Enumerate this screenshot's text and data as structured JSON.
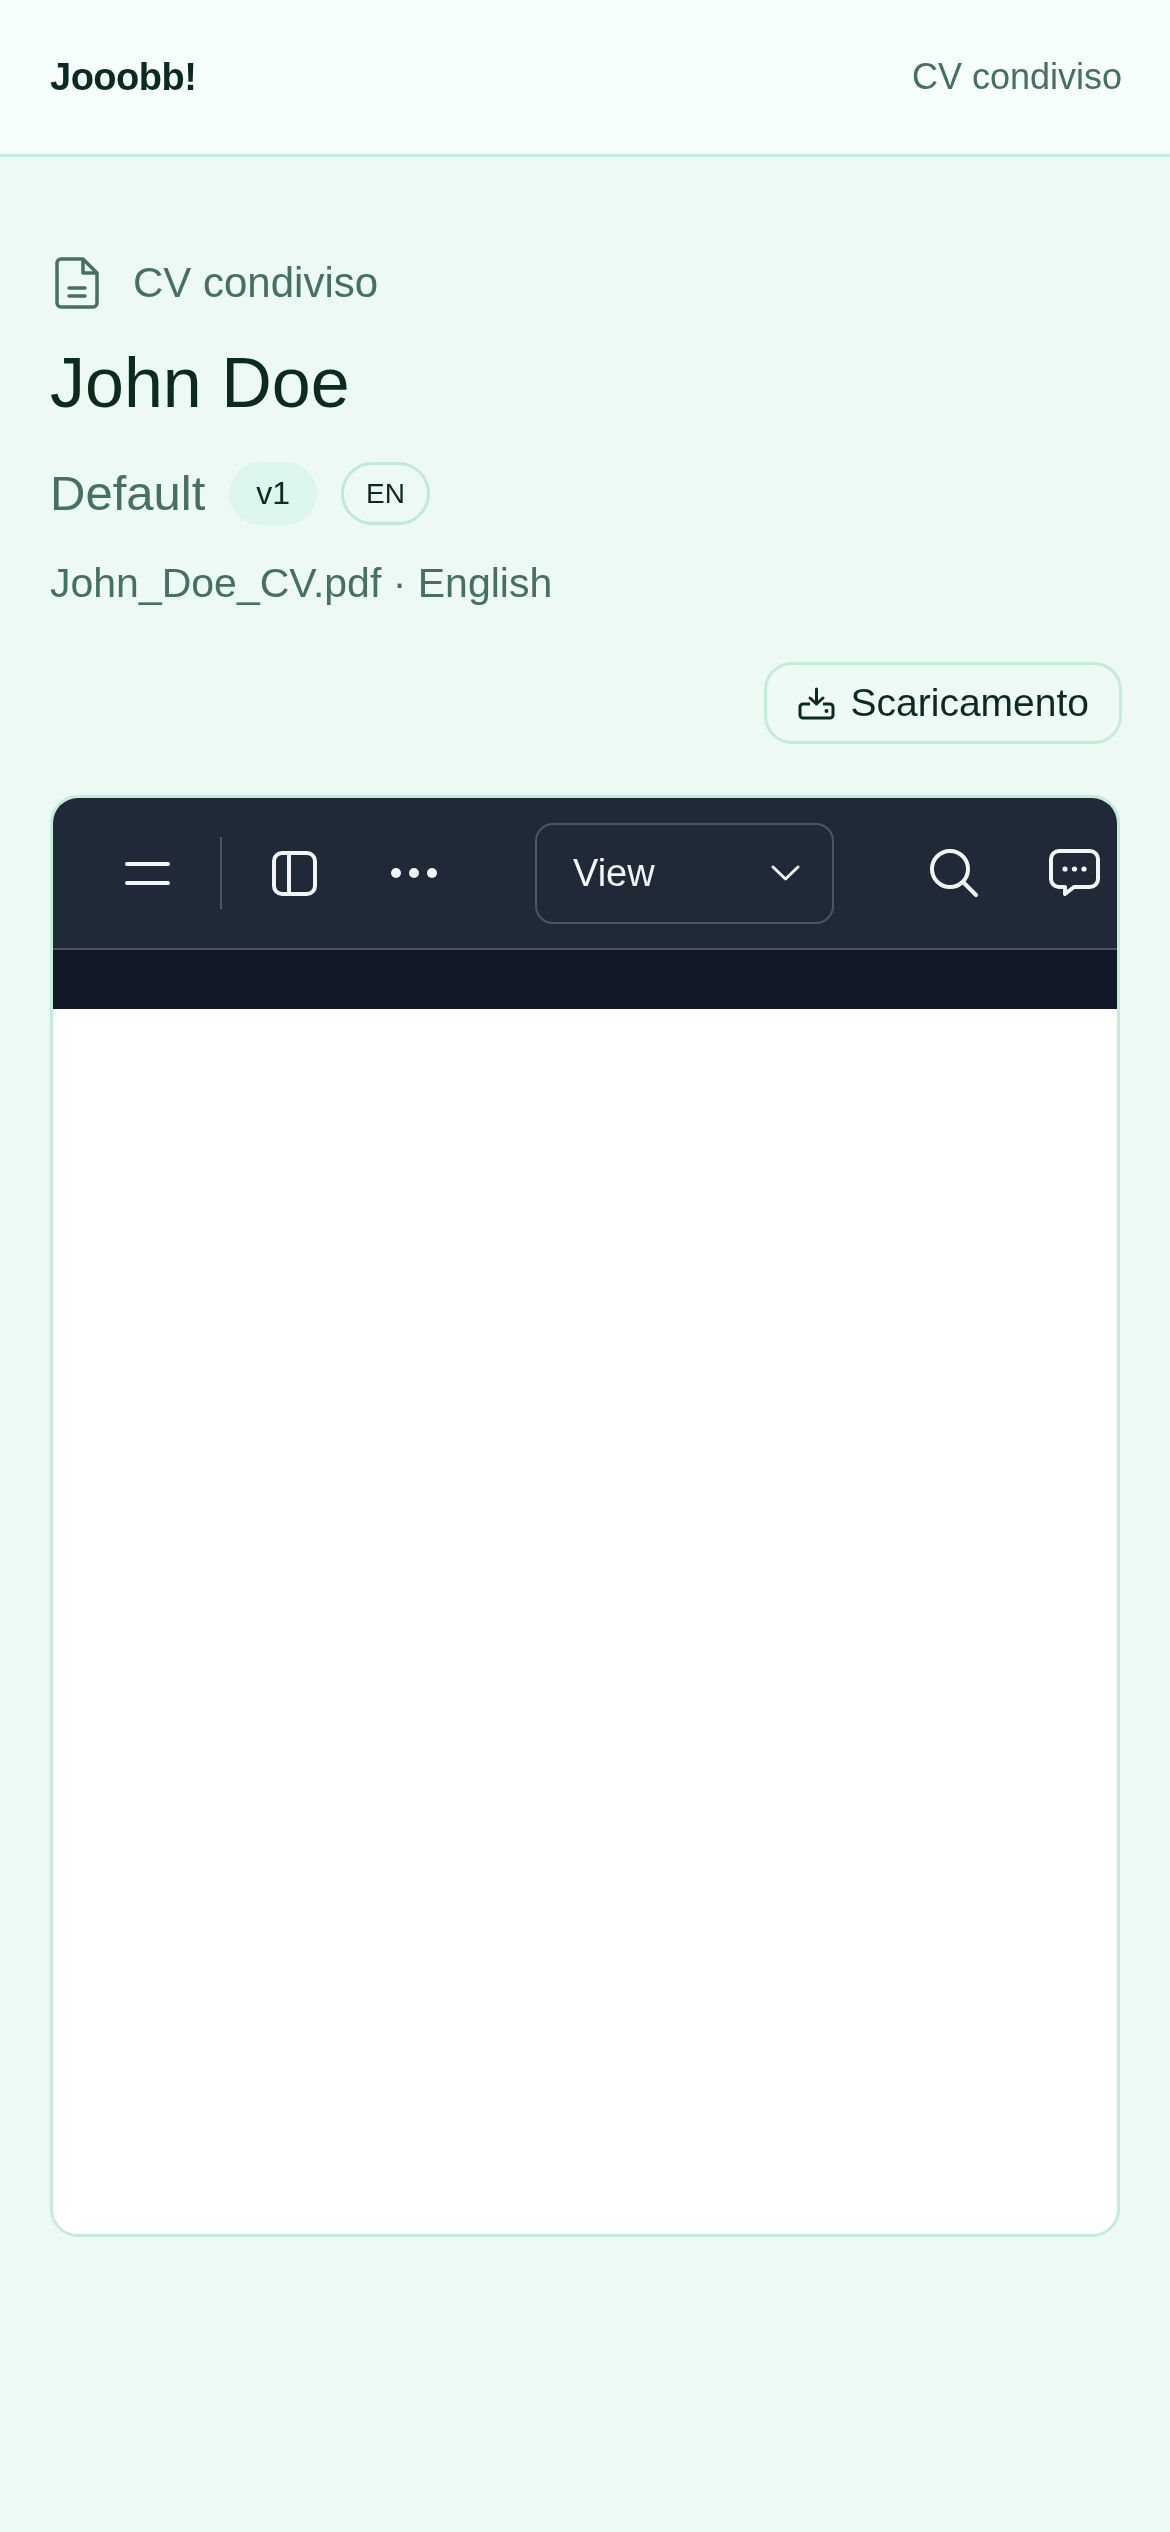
{
  "header": {
    "logo": "Jooobb!",
    "page_title": "CV condiviso"
  },
  "document": {
    "section_label": "CV condiviso",
    "name": "John Doe",
    "version_name": "Default",
    "badges": [
      {
        "kind": "filled",
        "label": "v1"
      },
      {
        "kind": "outline",
        "label": "EN"
      }
    ],
    "file_info": "John_Doe_CV.pdf · English",
    "download_button": "Scaricamento"
  },
  "viewer": {
    "toolbar": {
      "view_select": {
        "value": "View"
      }
    }
  }
}
